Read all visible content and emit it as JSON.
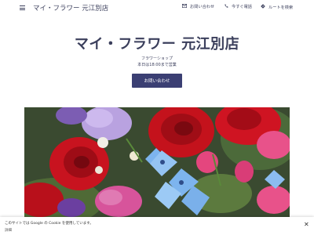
{
  "header": {
    "site_title": "マイ・フラワー 元江別店",
    "menu_icon": "hamburger-menu-icon",
    "nav": [
      {
        "label": "お問い合わせ",
        "icon": "mail-icon"
      },
      {
        "label": "今すぐ電話",
        "icon": "phone-icon"
      },
      {
        "label": "ルートを検索",
        "icon": "directions-icon"
      }
    ]
  },
  "hero": {
    "title": "マイ・フラワー 元江別店",
    "subtitle": "フラワーショップ",
    "hours": "本日は18:00まで営業",
    "cta_label": "お問い合わせ"
  },
  "cookie_banner": {
    "text": "このサイトでは Google の Cookie を使用しています。",
    "details_label": "詳細",
    "close_icon": "close-icon"
  },
  "colors": {
    "accent": "#3b3f73",
    "text": "#3b3f5c"
  }
}
